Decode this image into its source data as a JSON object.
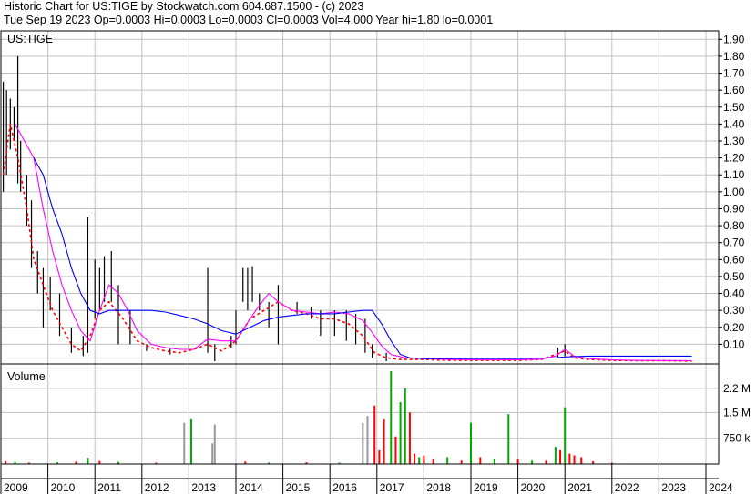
{
  "header": {
    "line1": "Historic Chart for US:TIGE by Stockwatch.com 604.687.1500 - (c) 2023",
    "line2": "Tue Sep 19 2023   Op=0.0003   Hi=0.0003   Lo=0.0003   Cl=0.0003   Vol=4,000   Year hi=1.80   lo=0.0001"
  },
  "chart_data": [
    {
      "type": "line",
      "label": "US:TIGE",
      "x_range": [
        2009.0,
        2024.0
      ],
      "ylim": [
        0.0,
        1.95
      ],
      "y_ticks": [
        "1.90",
        "1.80",
        "1.70",
        "1.60",
        "1.50",
        "1.40",
        "1.30",
        "1.20",
        "1.10",
        "1.00",
        "0.90",
        "0.80",
        "0.70",
        "0.60",
        "0.50",
        "0.40",
        "0.30",
        "0.20",
        "0.10"
      ],
      "grid": true,
      "colors": {
        "bars": "#000000",
        "close": "#ff0000",
        "ma_short": "#ff00ff",
        "ma_long": "#0000ff",
        "grid": "#c0c0c0"
      },
      "price_bars": [
        {
          "x": 2009.05,
          "lo": 1.0,
          "hi": 1.65
        },
        {
          "x": 2009.12,
          "lo": 1.1,
          "hi": 1.6
        },
        {
          "x": 2009.2,
          "lo": 1.25,
          "hi": 1.55
        },
        {
          "x": 2009.28,
          "lo": 1.3,
          "hi": 1.5
        },
        {
          "x": 2009.36,
          "lo": 1.05,
          "hi": 1.8
        },
        {
          "x": 2009.42,
          "lo": 1.0,
          "hi": 1.3
        },
        {
          "x": 2009.55,
          "lo": 0.8,
          "hi": 1.1
        },
        {
          "x": 2009.65,
          "lo": 0.55,
          "hi": 0.95
        },
        {
          "x": 2009.78,
          "lo": 0.4,
          "hi": 0.65
        },
        {
          "x": 2009.9,
          "lo": 0.2,
          "hi": 0.55
        },
        {
          "x": 2010.05,
          "lo": 0.3,
          "hi": 0.5
        },
        {
          "x": 2010.25,
          "lo": 0.15,
          "hi": 0.4
        },
        {
          "x": 2010.5,
          "lo": 0.05,
          "hi": 0.2
        },
        {
          "x": 2010.75,
          "lo": 0.03,
          "hi": 0.15
        },
        {
          "x": 2010.85,
          "lo": 0.05,
          "hi": 0.85
        },
        {
          "x": 2011.0,
          "lo": 0.25,
          "hi": 0.6
        },
        {
          "x": 2011.1,
          "lo": 0.3,
          "hi": 0.55
        },
        {
          "x": 2011.2,
          "lo": 0.35,
          "hi": 0.62
        },
        {
          "x": 2011.35,
          "lo": 0.35,
          "hi": 0.65
        },
        {
          "x": 2011.5,
          "lo": 0.1,
          "hi": 0.45
        },
        {
          "x": 2011.75,
          "lo": 0.1,
          "hi": 0.3
        },
        {
          "x": 2012.1,
          "lo": 0.06,
          "hi": 0.1
        },
        {
          "x": 2012.6,
          "lo": 0.04,
          "hi": 0.08
        },
        {
          "x": 2013.0,
          "lo": 0.06,
          "hi": 0.1
        },
        {
          "x": 2013.4,
          "lo": 0.05,
          "hi": 0.55
        },
        {
          "x": 2013.55,
          "lo": 0.0,
          "hi": 0.1
        },
        {
          "x": 2013.9,
          "lo": 0.08,
          "hi": 0.15
        },
        {
          "x": 2014.0,
          "lo": 0.1,
          "hi": 0.3
        },
        {
          "x": 2014.15,
          "lo": 0.35,
          "hi": 0.55
        },
        {
          "x": 2014.25,
          "lo": 0.3,
          "hi": 0.55
        },
        {
          "x": 2014.35,
          "lo": 0.35,
          "hi": 0.56
        },
        {
          "x": 2014.5,
          "lo": 0.3,
          "hi": 0.4
        },
        {
          "x": 2014.7,
          "lo": 0.2,
          "hi": 0.35
        },
        {
          "x": 2014.9,
          "lo": 0.1,
          "hi": 0.45
        },
        {
          "x": 2015.3,
          "lo": 0.28,
          "hi": 0.35
        },
        {
          "x": 2015.6,
          "lo": 0.25,
          "hi": 0.32
        },
        {
          "x": 2015.8,
          "lo": 0.15,
          "hi": 0.3
        },
        {
          "x": 2016.1,
          "lo": 0.15,
          "hi": 0.3
        },
        {
          "x": 2016.35,
          "lo": 0.12,
          "hi": 0.3
        },
        {
          "x": 2016.55,
          "lo": 0.1,
          "hi": 0.28
        },
        {
          "x": 2016.75,
          "lo": 0.05,
          "hi": 0.25
        },
        {
          "x": 2016.9,
          "lo": 0.02,
          "hi": 0.1
        },
        {
          "x": 2017.2,
          "lo": 0.0,
          "hi": 0.05
        },
        {
          "x": 2020.85,
          "lo": 0.02,
          "hi": 0.08
        },
        {
          "x": 2021.0,
          "lo": 0.03,
          "hi": 0.1
        }
      ],
      "series": [
        {
          "name": "close",
          "color": "#ff0000",
          "x": [
            2009.05,
            2009.2,
            2009.36,
            2009.55,
            2009.7,
            2009.9,
            2010.1,
            2010.3,
            2010.5,
            2010.7,
            2010.9,
            2011.1,
            2011.3,
            2011.6,
            2011.9,
            2012.2,
            2012.5,
            2012.8,
            2013.1,
            2013.4,
            2013.7,
            2014.0,
            2014.3,
            2014.6,
            2014.9,
            2015.2,
            2015.5,
            2015.8,
            2016.1,
            2016.4,
            2016.7,
            2016.95,
            2017.2,
            2017.5,
            2018.0,
            2018.5,
            2019.0,
            2019.5,
            2020.0,
            2020.5,
            2020.8,
            2021.0,
            2021.2,
            2021.5,
            2022.0,
            2022.5,
            2023.0,
            2023.7
          ],
          "y": [
            1.1,
            1.4,
            1.2,
            0.9,
            0.6,
            0.45,
            0.3,
            0.2,
            0.1,
            0.06,
            0.15,
            0.3,
            0.35,
            0.25,
            0.12,
            0.08,
            0.06,
            0.05,
            0.07,
            0.1,
            0.06,
            0.12,
            0.25,
            0.3,
            0.35,
            0.3,
            0.28,
            0.25,
            0.25,
            0.22,
            0.15,
            0.05,
            0.02,
            0.01,
            0.01,
            0.005,
            0.005,
            0.005,
            0.005,
            0.01,
            0.04,
            0.06,
            0.02,
            0.01,
            0.005,
            0.003,
            0.003,
            0.0003
          ]
        },
        {
          "name": "ma_short",
          "color": "#ff00ff",
          "x": [
            2009.3,
            2009.5,
            2009.7,
            2009.9,
            2010.1,
            2010.3,
            2010.5,
            2010.7,
            2010.9,
            2011.1,
            2011.3,
            2011.5,
            2011.7,
            2011.9,
            2012.2,
            2012.5,
            2012.8,
            2013.1,
            2013.4,
            2013.7,
            2014.0,
            2014.3,
            2014.5,
            2014.7,
            2014.9,
            2015.2,
            2015.5,
            2015.8,
            2016.1,
            2016.4,
            2016.7,
            2016.9,
            2017.1,
            2017.3,
            2017.6,
            2018.0,
            2018.5,
            2019.0,
            2019.5,
            2020.0,
            2020.5,
            2020.8,
            2021.0,
            2021.2,
            2021.5,
            2022.0,
            2022.5,
            2023.0,
            2023.7
          ],
          "y": [
            1.4,
            1.3,
            1.2,
            0.9,
            0.65,
            0.45,
            0.3,
            0.18,
            0.12,
            0.3,
            0.45,
            0.4,
            0.3,
            0.18,
            0.1,
            0.08,
            0.07,
            0.07,
            0.13,
            0.12,
            0.12,
            0.25,
            0.33,
            0.4,
            0.35,
            0.3,
            0.29,
            0.28,
            0.29,
            0.28,
            0.24,
            0.17,
            0.09,
            0.04,
            0.02,
            0.015,
            0.01,
            0.008,
            0.008,
            0.008,
            0.012,
            0.03,
            0.07,
            0.03,
            0.015,
            0.008,
            0.005,
            0.004,
            0.003
          ]
        },
        {
          "name": "ma_long",
          "color": "#0000ff",
          "x": [
            2009.7,
            2009.9,
            2010.1,
            2010.3,
            2010.5,
            2010.7,
            2010.9,
            2011.1,
            2011.3,
            2011.6,
            2011.9,
            2012.2,
            2012.5,
            2012.8,
            2013.1,
            2013.4,
            2013.7,
            2014.0,
            2014.3,
            2014.6,
            2014.9,
            2015.2,
            2015.5,
            2015.8,
            2016.1,
            2016.4,
            2016.7,
            2016.9,
            2017.1,
            2017.3,
            2017.5,
            2017.7,
            2018.0,
            2018.5,
            2019.0,
            2019.5,
            2020.0,
            2020.5,
            2020.8,
            2021.0,
            2021.5,
            2022.0,
            2022.5,
            2023.0,
            2023.7
          ],
          "y": [
            1.2,
            1.1,
            0.9,
            0.75,
            0.55,
            0.4,
            0.3,
            0.28,
            0.3,
            0.3,
            0.3,
            0.3,
            0.29,
            0.27,
            0.25,
            0.22,
            0.18,
            0.16,
            0.2,
            0.24,
            0.26,
            0.27,
            0.28,
            0.28,
            0.28,
            0.29,
            0.3,
            0.3,
            0.22,
            0.12,
            0.04,
            0.02,
            0.015,
            0.015,
            0.015,
            0.015,
            0.015,
            0.018,
            0.02,
            0.025,
            0.03,
            0.03,
            0.03,
            0.03,
            0.03
          ]
        }
      ]
    },
    {
      "type": "bar",
      "label": "Volume",
      "x_range": [
        2009.0,
        2024.0
      ],
      "ylim": [
        0,
        2700000
      ],
      "y_ticks": [
        "2.2 M",
        "1.5 M",
        "750 k"
      ],
      "y_tick_values": [
        2200000,
        1500000,
        750000
      ],
      "grid": true,
      "bars": [
        {
          "x": 2009.1,
          "v": 80000,
          "c": "#ff0000"
        },
        {
          "x": 2009.3,
          "v": 60000,
          "c": "#00aa00"
        },
        {
          "x": 2009.6,
          "v": 40000,
          "c": "#ff0000"
        },
        {
          "x": 2010.2,
          "v": 50000,
          "c": "#00aa00"
        },
        {
          "x": 2010.6,
          "v": 70000,
          "c": "#ff0000"
        },
        {
          "x": 2010.85,
          "v": 180000,
          "c": "#00aa00"
        },
        {
          "x": 2011.1,
          "v": 90000,
          "c": "#ff0000"
        },
        {
          "x": 2011.5,
          "v": 60000,
          "c": "#00aa00"
        },
        {
          "x": 2012.3,
          "v": 40000,
          "c": "#ff0000"
        },
        {
          "x": 2012.9,
          "v": 1200000,
          "c": "#999999"
        },
        {
          "x": 2013.05,
          "v": 1300000,
          "c": "#00aa00"
        },
        {
          "x": 2013.5,
          "v": 600000,
          "c": "#999999"
        },
        {
          "x": 2013.55,
          "v": 1150000,
          "c": "#999999"
        },
        {
          "x": 2014.2,
          "v": 70000,
          "c": "#ff0000"
        },
        {
          "x": 2014.7,
          "v": 40000,
          "c": "#00aa00"
        },
        {
          "x": 2015.5,
          "v": 50000,
          "c": "#ff0000"
        },
        {
          "x": 2016.2,
          "v": 40000,
          "c": "#00aa00"
        },
        {
          "x": 2016.7,
          "v": 1200000,
          "c": "#999999"
        },
        {
          "x": 2016.8,
          "v": 1400000,
          "c": "#999999"
        },
        {
          "x": 2016.95,
          "v": 1700000,
          "c": "#ff0000"
        },
        {
          "x": 2017.05,
          "v": 400000,
          "c": "#ff0000"
        },
        {
          "x": 2017.15,
          "v": 1300000,
          "c": "#ff0000"
        },
        {
          "x": 2017.3,
          "v": 2700000,
          "c": "#00aa00"
        },
        {
          "x": 2017.4,
          "v": 800000,
          "c": "#ff0000"
        },
        {
          "x": 2017.5,
          "v": 1800000,
          "c": "#00aa00"
        },
        {
          "x": 2017.6,
          "v": 2200000,
          "c": "#00aa00"
        },
        {
          "x": 2017.7,
          "v": 1500000,
          "c": "#ff0000"
        },
        {
          "x": 2017.8,
          "v": 300000,
          "c": "#ff0000"
        },
        {
          "x": 2017.9,
          "v": 200000,
          "c": "#00aa00"
        },
        {
          "x": 2018.0,
          "v": 250000,
          "c": "#ff0000"
        },
        {
          "x": 2018.2,
          "v": 150000,
          "c": "#ff0000"
        },
        {
          "x": 2018.5,
          "v": 200000,
          "c": "#00aa00"
        },
        {
          "x": 2018.8,
          "v": 100000,
          "c": "#ff0000"
        },
        {
          "x": 2019.0,
          "v": 1200000,
          "c": "#00aa00"
        },
        {
          "x": 2019.2,
          "v": 200000,
          "c": "#ff0000"
        },
        {
          "x": 2019.5,
          "v": 150000,
          "c": "#00aa00"
        },
        {
          "x": 2019.8,
          "v": 1450000,
          "c": "#00aa00"
        },
        {
          "x": 2020.0,
          "v": 150000,
          "c": "#ff0000"
        },
        {
          "x": 2020.3,
          "v": 100000,
          "c": "#00aa00"
        },
        {
          "x": 2020.6,
          "v": 100000,
          "c": "#ff0000"
        },
        {
          "x": 2020.8,
          "v": 500000,
          "c": "#00aa00"
        },
        {
          "x": 2020.9,
          "v": 400000,
          "c": "#ff0000"
        },
        {
          "x": 2021.0,
          "v": 1650000,
          "c": "#00aa00"
        },
        {
          "x": 2021.1,
          "v": 300000,
          "c": "#ff0000"
        },
        {
          "x": 2021.2,
          "v": 250000,
          "c": "#ff0000"
        },
        {
          "x": 2021.35,
          "v": 200000,
          "c": "#ff0000"
        },
        {
          "x": 2021.6,
          "v": 80000,
          "c": "#ff0000"
        },
        {
          "x": 2022.0,
          "v": 40000,
          "c": "#ff0000"
        }
      ]
    }
  ],
  "x_axis": {
    "labels": [
      "2009",
      "2010",
      "2011",
      "2012",
      "2013",
      "2014",
      "2015",
      "2016",
      "2017",
      "2018",
      "2019",
      "2020",
      "2021",
      "2022",
      "2023",
      "2024"
    ],
    "values": [
      2009,
      2010,
      2011,
      2012,
      2013,
      2014,
      2015,
      2016,
      2017,
      2018,
      2019,
      2020,
      2021,
      2022,
      2023,
      2024
    ]
  }
}
